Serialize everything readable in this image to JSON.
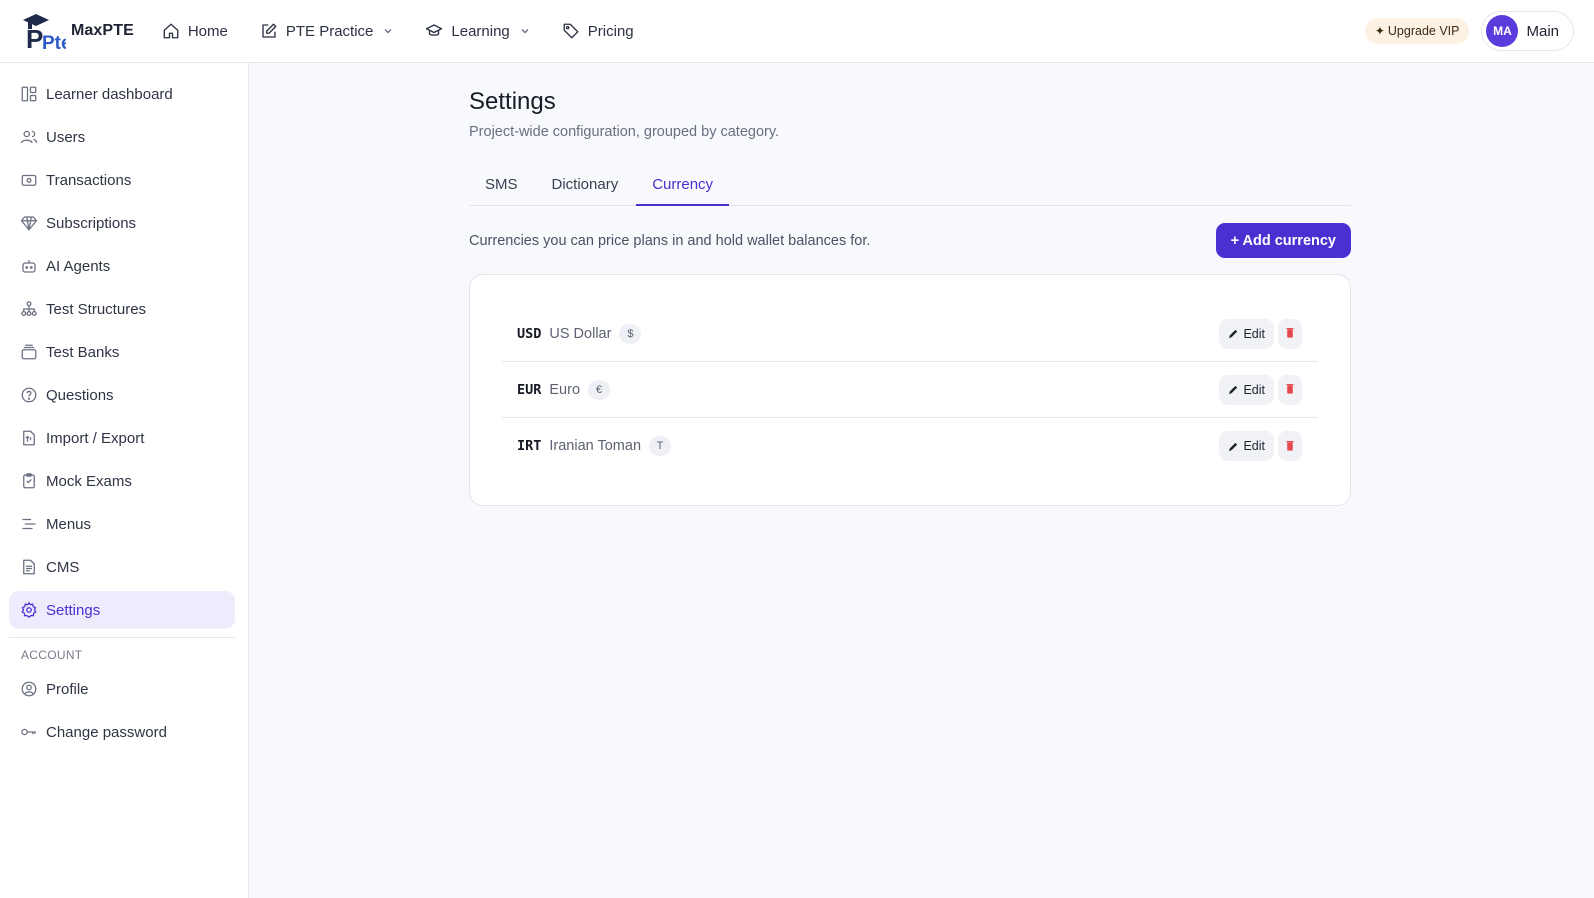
{
  "brand": {
    "name": "MaxPTE",
    "logo_text": "Pte"
  },
  "nav": [
    {
      "label": "Home",
      "icon": "home-icon",
      "dropdown": false
    },
    {
      "label": "PTE Practice",
      "icon": "edit-square-icon",
      "dropdown": true
    },
    {
      "label": "Learning",
      "icon": "graduation-cap-icon",
      "dropdown": true
    },
    {
      "label": "Pricing",
      "icon": "tag-icon",
      "dropdown": false
    }
  ],
  "top_right": {
    "vip_label": "Upgrade VIP",
    "vip_star": "✦",
    "avatar_initials": "MA",
    "user_name": "Main"
  },
  "sidebar": {
    "items": [
      {
        "label": "Learner dashboard",
        "icon": "dashboard-icon"
      },
      {
        "label": "Users",
        "icon": "users-icon"
      },
      {
        "label": "Transactions",
        "icon": "banknote-icon"
      },
      {
        "label": "Subscriptions",
        "icon": "gem-icon"
      },
      {
        "label": "AI Agents",
        "icon": "robot-icon"
      },
      {
        "label": "Test Structures",
        "icon": "hierarchy-icon"
      },
      {
        "label": "Test Banks",
        "icon": "stack-icon"
      },
      {
        "label": "Questions",
        "icon": "help-circle-icon"
      },
      {
        "label": "Import / Export",
        "icon": "file-transfer-icon"
      },
      {
        "label": "Mock Exams",
        "icon": "clipboard-icon"
      },
      {
        "label": "Menus",
        "icon": "menu-lines-icon"
      },
      {
        "label": "CMS",
        "icon": "document-icon"
      },
      {
        "label": "Settings",
        "icon": "gear-icon",
        "active": true
      }
    ],
    "account_section": "ACCOUNT",
    "account_items": [
      {
        "label": "Profile",
        "icon": "user-circle-icon"
      },
      {
        "label": "Change password",
        "icon": "key-icon"
      }
    ]
  },
  "main": {
    "title": "Settings",
    "subtitle": "Project-wide configuration, grouped by category.",
    "tabs": [
      {
        "label": "SMS"
      },
      {
        "label": "Dictionary"
      },
      {
        "label": "Currency",
        "active": true
      }
    ],
    "description": "Currencies you can price plans in and hold wallet balances for.",
    "add_button": "+ Add currency",
    "edit_label": "Edit",
    "currencies": [
      {
        "code": "USD",
        "name": "US Dollar",
        "symbol": "$"
      },
      {
        "code": "EUR",
        "name": "Euro",
        "symbol": "€"
      },
      {
        "code": "IRT",
        "name": "Iranian Toman",
        "symbol": "T"
      }
    ]
  },
  "colors": {
    "accent": "#4b2fd0",
    "active_bg": "#efebfd",
    "vip_bg": "#fdf1e3",
    "delete": "#e5484d"
  }
}
